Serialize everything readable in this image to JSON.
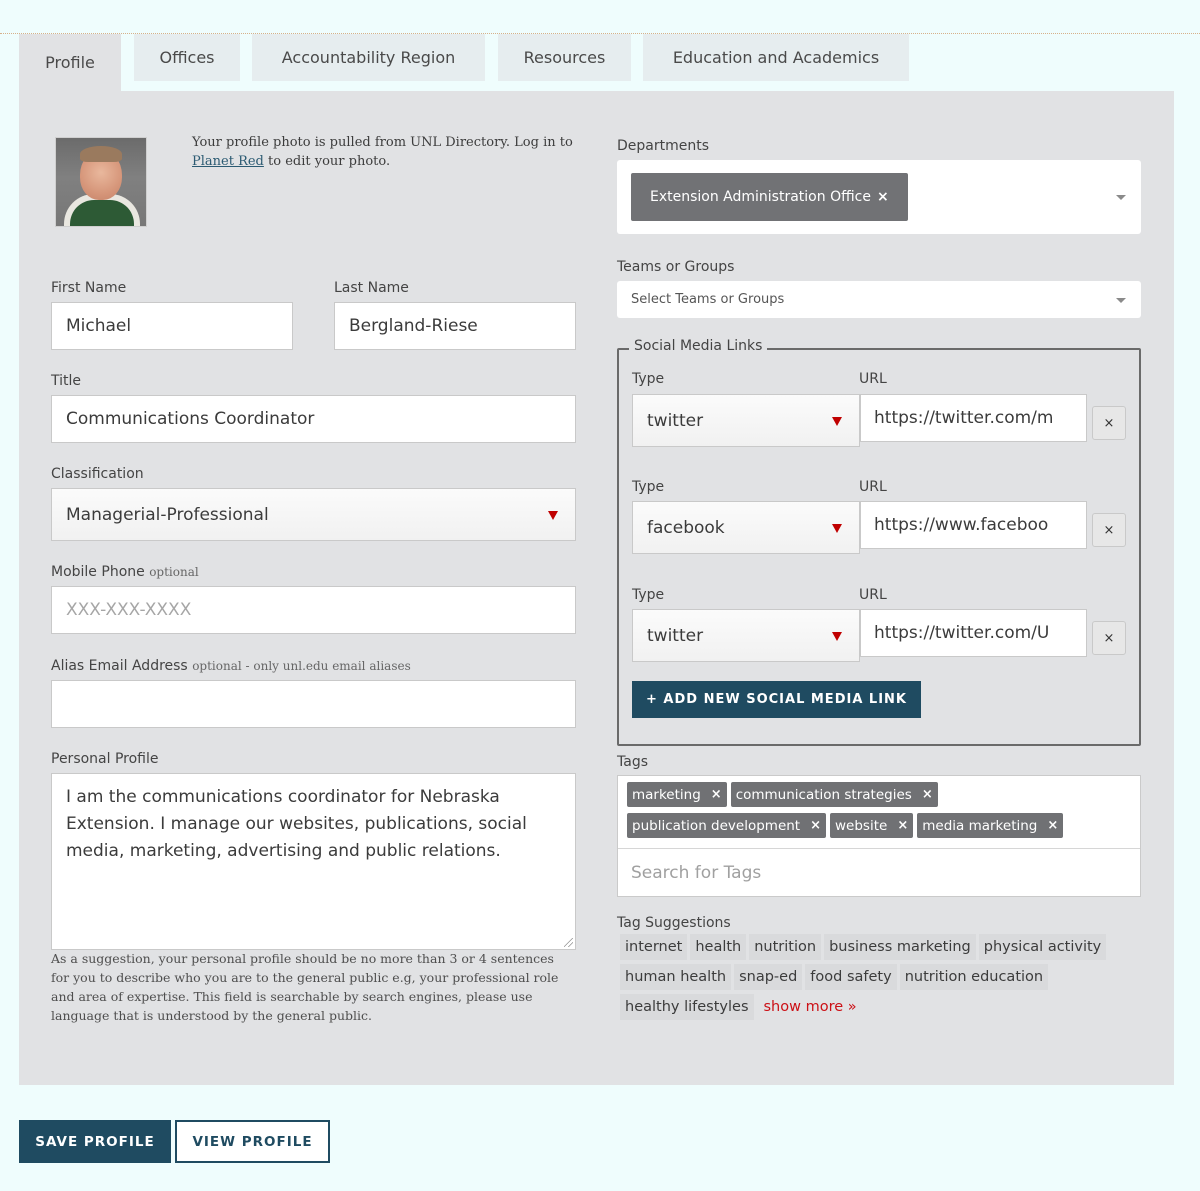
{
  "tabs": [
    {
      "label": "Profile",
      "active": true
    },
    {
      "label": "Offices",
      "active": false
    },
    {
      "label": "Accountability Region",
      "active": false
    },
    {
      "label": "Resources",
      "active": false
    },
    {
      "label": "Education and Academics",
      "active": false
    }
  ],
  "photo": {
    "note_before": "Your profile photo is pulled from UNL Directory. Log in to ",
    "link": "Planet Red",
    "note_after": " to edit your photo."
  },
  "fields": {
    "first_name": {
      "label": "First Name",
      "value": "Michael"
    },
    "last_name": {
      "label": "Last Name",
      "value": "Bergland-Riese"
    },
    "title": {
      "label": "Title",
      "value": "Communications Coordinator"
    },
    "classification": {
      "label": "Classification",
      "value": "Managerial-Professional"
    },
    "mobile_phone": {
      "label": "Mobile Phone",
      "hint": "optional",
      "placeholder": "XXX-XXX-XXXX",
      "value": ""
    },
    "alias_email": {
      "label": "Alias Email Address",
      "hint": "optional - only unl.edu email aliases",
      "value": ""
    },
    "personal_profile": {
      "label": "Personal Profile",
      "value": "I am the communications coordinator for Nebraska Extension. I manage our websites, publications, social media, marketing, advertising and public relations.",
      "help": "As a suggestion, your personal profile should be no more than 3 or 4 sentences for you to describe who you are to the general public e.g, your professional role and area of expertise. This field is searchable by search engines, please use language that is understood by the general public."
    }
  },
  "departments": {
    "label": "Departments",
    "selected": [
      {
        "label": "Extension Administration Office",
        "remove": "×"
      }
    ]
  },
  "teams": {
    "label": "Teams or Groups",
    "placeholder": "Select Teams or Groups"
  },
  "social": {
    "legend": "Social Media Links",
    "type_label": "Type",
    "url_label": "URL",
    "remove": "×",
    "links": [
      {
        "type": "twitter",
        "url": "https://twitter.com/m"
      },
      {
        "type": "facebook",
        "url": "https://www.faceboo"
      },
      {
        "type": "twitter",
        "url": "https://twitter.com/U"
      }
    ],
    "add_label": "+ ADD NEW SOCIAL MEDIA LINK"
  },
  "tags": {
    "label": "Tags",
    "selected": [
      "marketing",
      "communication strategies",
      "publication development",
      "website",
      "media marketing"
    ],
    "remove": "×",
    "search_placeholder": "Search for Tags"
  },
  "tag_suggestions": {
    "label": "Tag Suggestions",
    "items": [
      "internet",
      "health",
      "nutrition",
      "business marketing",
      "physical activity",
      "human health",
      "snap-ed",
      "food safety",
      "nutrition education",
      "healthy lifestyles"
    ],
    "show_more": "show more »"
  },
  "actions": {
    "save": "SAVE PROFILE",
    "view": "VIEW PROFILE"
  },
  "colors": {
    "primary": "#1f4b61",
    "accent_red": "#cc1016",
    "page_bg": "#effdfd",
    "panel_bg": "#e1e2e4",
    "chip_bg": "#707174"
  }
}
